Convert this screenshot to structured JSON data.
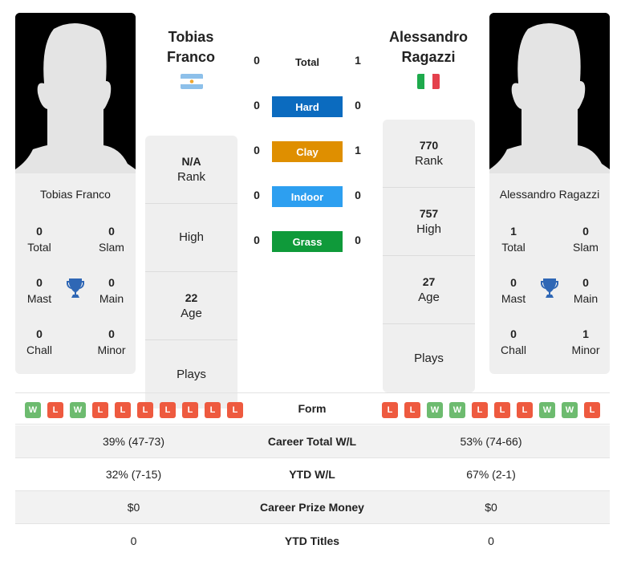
{
  "player1": {
    "name_line1": "Tobias",
    "name_line2": "Franco",
    "card_name": "Tobias Franco",
    "country": "Argentina",
    "flag_icon": "argentina-flag-icon",
    "titles": {
      "total": {
        "value": "0",
        "label": "Total"
      },
      "slam": {
        "value": "0",
        "label": "Slam"
      },
      "mast": {
        "value": "0",
        "label": "Mast"
      },
      "main": {
        "value": "0",
        "label": "Main"
      },
      "chall": {
        "value": "0",
        "label": "Chall"
      },
      "minor": {
        "value": "0",
        "label": "Minor"
      }
    },
    "info": {
      "rank": {
        "value": "N/A",
        "label": "Rank"
      },
      "high": {
        "value": "",
        "label": "High"
      },
      "age": {
        "value": "22",
        "label": "Age"
      },
      "plays": {
        "value": "",
        "label": "Plays"
      }
    },
    "form": [
      "W",
      "L",
      "W",
      "L",
      "L",
      "L",
      "L",
      "L",
      "L",
      "L"
    ]
  },
  "player2": {
    "name_line1": "Alessandro",
    "name_line2": "Ragazzi",
    "card_name": "Alessandro Ragazzi",
    "country": "Italy",
    "flag_icon": "italy-flag-icon",
    "titles": {
      "total": {
        "value": "1",
        "label": "Total"
      },
      "slam": {
        "value": "0",
        "label": "Slam"
      },
      "mast": {
        "value": "0",
        "label": "Mast"
      },
      "main": {
        "value": "0",
        "label": "Main"
      },
      "chall": {
        "value": "0",
        "label": "Chall"
      },
      "minor": {
        "value": "1",
        "label": "Minor"
      }
    },
    "info": {
      "rank": {
        "value": "770",
        "label": "Rank"
      },
      "high": {
        "value": "757",
        "label": "High"
      },
      "age": {
        "value": "27",
        "label": "Age"
      },
      "plays": {
        "value": "",
        "label": "Plays"
      }
    },
    "form": [
      "L",
      "L",
      "W",
      "W",
      "L",
      "L",
      "L",
      "W",
      "W",
      "L"
    ]
  },
  "h2h": {
    "total": {
      "label": "Total",
      "p1": "0",
      "p2": "1"
    },
    "surfaces": [
      {
        "label": "Hard",
        "p1": "0",
        "p2": "0",
        "color": "#0b6bbf"
      },
      {
        "label": "Clay",
        "p1": "0",
        "p2": "1",
        "color": "#df8f00"
      },
      {
        "label": "Indoor",
        "p1": "0",
        "p2": "0",
        "color": "#2d9ff0"
      },
      {
        "label": "Grass",
        "p1": "0",
        "p2": "0",
        "color": "#0f9a3a"
      }
    ]
  },
  "form_label": "Form",
  "stats": [
    {
      "label": "Career Total W/L",
      "p1": "39% (47-73)",
      "p2": "53% (74-66)"
    },
    {
      "label": "YTD W/L",
      "p1": "32% (7-15)",
      "p2": "67% (2-1)"
    },
    {
      "label": "Career Prize Money",
      "p1": "$0",
      "p2": "$0"
    },
    {
      "label": "YTD Titles",
      "p1": "0",
      "p2": "0"
    }
  ]
}
